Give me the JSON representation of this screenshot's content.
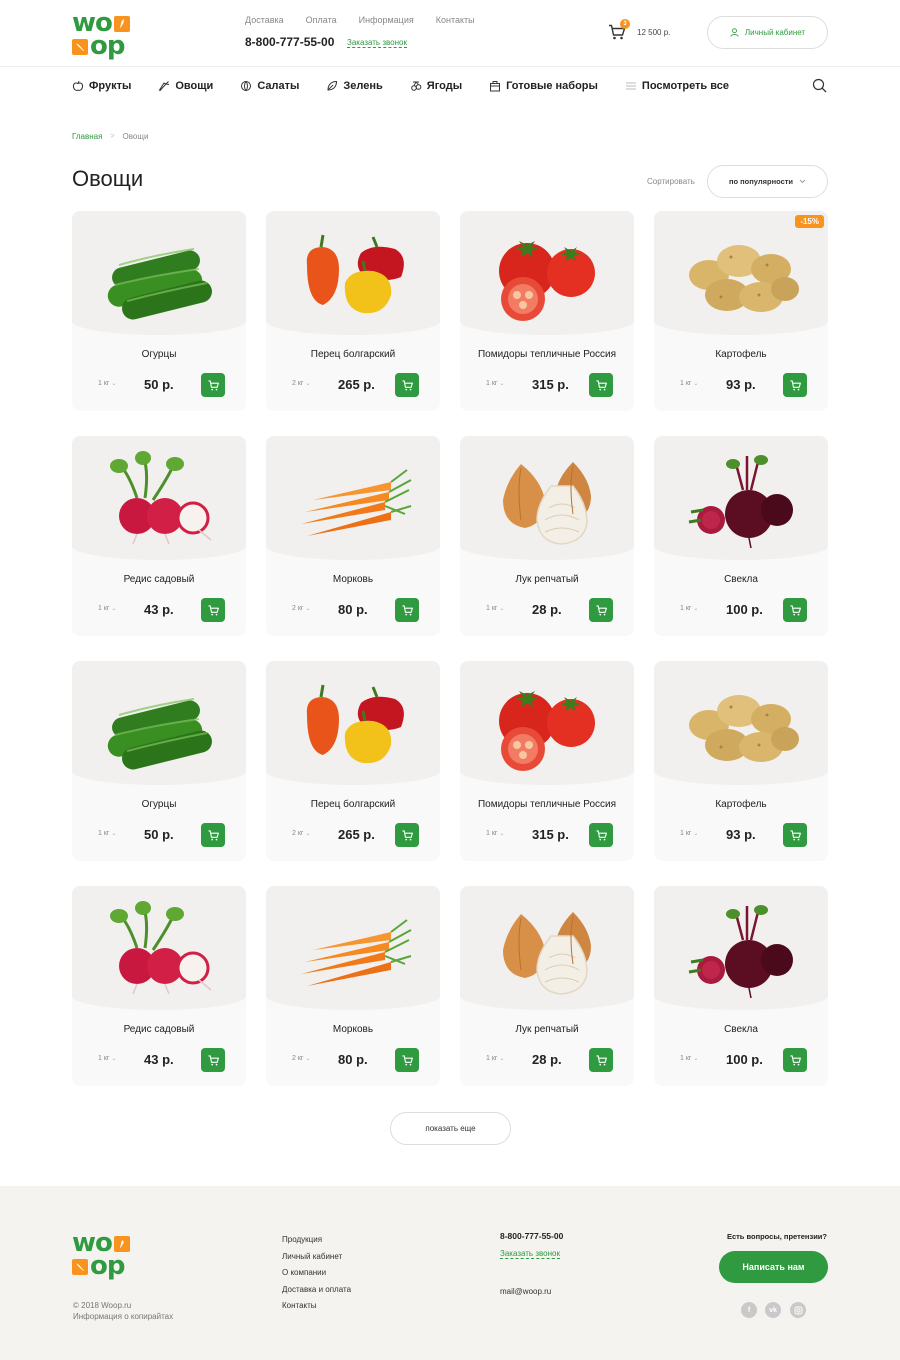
{
  "header": {
    "logo_top": "wo",
    "logo_bottom": "op",
    "links": [
      "Доставка",
      "Оплата",
      "Информация",
      "Контакты"
    ],
    "phone": "8-800-777-55-00",
    "callback": "Заказать звонок",
    "cart_count": "3",
    "cart_sum": "12 500 р.",
    "account": "Личный кабинет"
  },
  "nav": {
    "categories": [
      "Фрукты",
      "Овощи",
      "Салаты",
      "Зелень",
      "Ягоды",
      "Готовые наборы",
      "Посмотреть все"
    ]
  },
  "breadcrumb": {
    "home": "Главная",
    "current": "Овощи",
    "sep": ">"
  },
  "page": {
    "title": "Овощи",
    "sort_label": "Сортировать",
    "sort_value": "по популярности",
    "show_more": "показать еще"
  },
  "products": [
    {
      "name": "Огурцы",
      "weight": "1 кг",
      "price": "50 р.",
      "img": "cucumber",
      "badge": ""
    },
    {
      "name": "Перец болгарский",
      "weight": "2 кг",
      "price": "265 р.",
      "img": "pepper",
      "badge": ""
    },
    {
      "name": "Помидоры тепличные Россия",
      "weight": "1 кг",
      "price": "315 р.",
      "img": "tomato",
      "badge": ""
    },
    {
      "name": "Картофель",
      "weight": "1 кг",
      "price": "93 р.",
      "img": "potato",
      "badge": "-15%"
    },
    {
      "name": "Редис садовый",
      "weight": "1 кг",
      "price": "43 р.",
      "img": "radish",
      "badge": ""
    },
    {
      "name": "Морковь",
      "weight": "2 кг",
      "price": "80 р.",
      "img": "carrot",
      "badge": ""
    },
    {
      "name": "Лук репчатый",
      "weight": "1 кг",
      "price": "28 р.",
      "img": "onion",
      "badge": ""
    },
    {
      "name": "Свекла",
      "weight": "1 кг",
      "price": "100 р.",
      "img": "beet",
      "badge": ""
    },
    {
      "name": "Огурцы",
      "weight": "1 кг",
      "price": "50 р.",
      "img": "cucumber",
      "badge": ""
    },
    {
      "name": "Перец болгарский",
      "weight": "2 кг",
      "price": "265 р.",
      "img": "pepper",
      "badge": ""
    },
    {
      "name": "Помидоры тепличные Россия",
      "weight": "1 кг",
      "price": "315 р.",
      "img": "tomato",
      "badge": ""
    },
    {
      "name": "Картофель",
      "weight": "1 кг",
      "price": "93 р.",
      "img": "potato",
      "badge": ""
    },
    {
      "name": "Редис садовый",
      "weight": "1 кг",
      "price": "43 р.",
      "img": "radish",
      "badge": ""
    },
    {
      "name": "Морковь",
      "weight": "2 кг",
      "price": "80 р.",
      "img": "carrot",
      "badge": ""
    },
    {
      "name": "Лук репчатый",
      "weight": "1 кг",
      "price": "28 р.",
      "img": "onion",
      "badge": ""
    },
    {
      "name": "Свекла",
      "weight": "1 кг",
      "price": "100 р.",
      "img": "beet",
      "badge": ""
    }
  ],
  "footer": {
    "copyright": "© 2018 Woop.ru",
    "copyright_info": "Информация о копирайтах",
    "menu": [
      "Продукция",
      "Личный кабинет",
      "О компании",
      "Доставка и оплата",
      "Контакты"
    ],
    "phone": "8-800-777-55-00",
    "callback": "Заказать звонок",
    "email": "mail@woop.ru",
    "question": "Есть вопросы, претензии?",
    "write_button": "Написать нам",
    "socials": [
      "facebook-icon",
      "vk-icon",
      "instagram-icon"
    ]
  },
  "colors": {
    "accent": "#2f9a3f",
    "orange": "#f7931e"
  }
}
